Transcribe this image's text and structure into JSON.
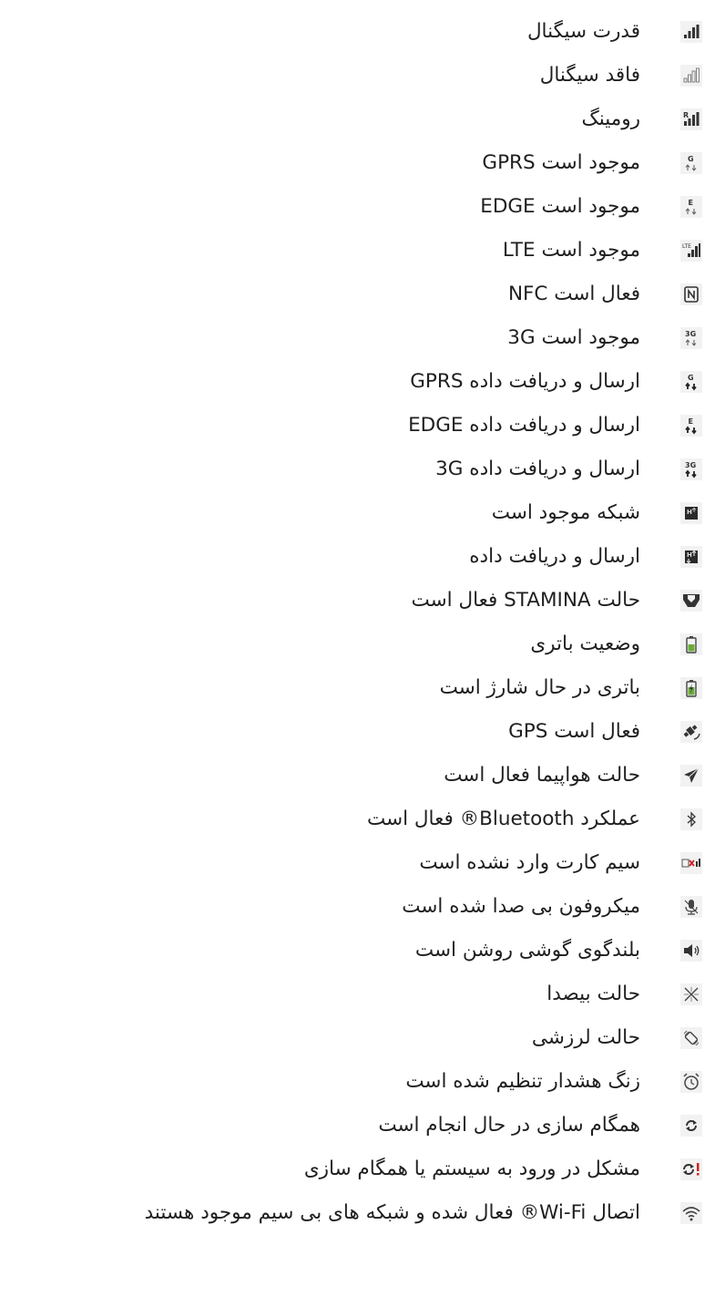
{
  "items": [
    {
      "icon": "signal-strength-icon",
      "label": "قدرت سیگنال"
    },
    {
      "icon": "no-signal-icon",
      "label": "فاقد سیگنال"
    },
    {
      "icon": "roaming-icon",
      "label": "رومینگ"
    },
    {
      "icon": "gprs-available-icon",
      "label": "GPRS موجود است"
    },
    {
      "icon": "edge-available-icon",
      "label": "EDGE موجود است"
    },
    {
      "icon": "lte-available-icon",
      "label": "LTE موجود است"
    },
    {
      "icon": "nfc-icon",
      "label": "NFC فعال است"
    },
    {
      "icon": "3g-available-icon",
      "label": "3G موجود است"
    },
    {
      "icon": "gprs-data-icon",
      "label": "ارسال و دریافت داده GPRS"
    },
    {
      "icon": "edge-data-icon",
      "label": "ارسال و دریافت داده EDGE"
    },
    {
      "icon": "3g-data-icon",
      "label": "ارسال و دریافت داده 3G"
    },
    {
      "icon": "network-available-icon",
      "label": "شبکه موجود است"
    },
    {
      "icon": "network-data-icon",
      "label": "ارسال و دریافت داده"
    },
    {
      "icon": "stamina-icon",
      "label": "حالت STAMINA فعال است"
    },
    {
      "icon": "battery-status-icon",
      "label": "وضعیت باتری"
    },
    {
      "icon": "battery-charging-icon",
      "label": "باتری در حال شارژ است"
    },
    {
      "icon": "gps-icon",
      "label": "GPS فعال است"
    },
    {
      "icon": "airplane-mode-icon",
      "label": "حالت هواپیما فعال است"
    },
    {
      "icon": "bluetooth-icon",
      "label": "عملکرد Bluetooth® فعال است"
    },
    {
      "icon": "no-sim-icon",
      "label": "سیم کارت وارد نشده است"
    },
    {
      "icon": "mic-muted-icon",
      "label": "میکروفون بی صدا شده است"
    },
    {
      "icon": "speakerphone-icon",
      "label": "بلندگوی گوشی روشن است"
    },
    {
      "icon": "silent-mode-icon",
      "label": "حالت بیصدا"
    },
    {
      "icon": "vibrate-mode-icon",
      "label": "حالت لرزشی"
    },
    {
      "icon": "alarm-icon",
      "label": "زنگ هشدار تنظیم شده است"
    },
    {
      "icon": "sync-icon",
      "label": "همگام سازی در حال انجام است"
    },
    {
      "icon": "sync-error-icon",
      "label": "مشکل در ورود به سیستم یا همگام سازی"
    },
    {
      "icon": "wifi-icon",
      "label": "اتصال Wi-Fi® فعال شده و شبکه های بی سیم موجود هستند"
    }
  ]
}
